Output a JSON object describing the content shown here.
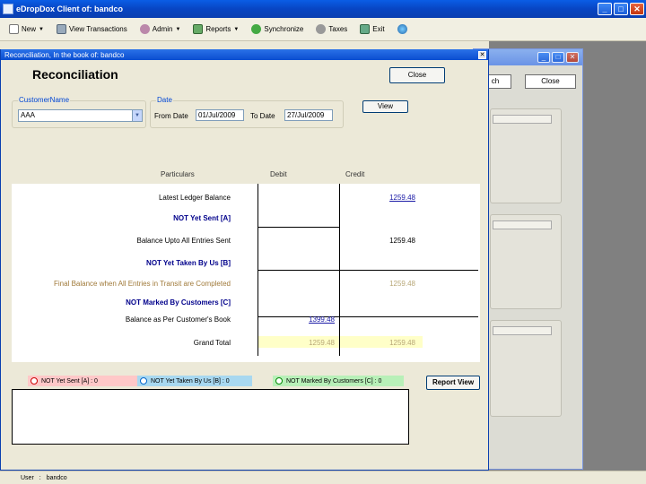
{
  "app": {
    "title": "eDropDox Client of: bandco"
  },
  "toolbar": {
    "items": [
      {
        "label": "New",
        "icon": "new-document-icon",
        "has_menu": true
      },
      {
        "label": "View Transactions",
        "icon": "view-transactions-icon",
        "has_menu": false
      },
      {
        "label": "Admin",
        "icon": "admin-icon",
        "has_menu": true
      },
      {
        "label": "Reports",
        "icon": "reports-icon",
        "has_menu": true
      },
      {
        "label": "Synchronize",
        "icon": "synchronize-icon",
        "has_menu": false
      },
      {
        "label": "Taxes",
        "icon": "taxes-icon",
        "has_menu": false
      },
      {
        "label": "Exit",
        "icon": "exit-icon",
        "has_menu": false
      }
    ],
    "globe_icon": "globe-icon"
  },
  "background_window": {
    "search_label": "ch",
    "close_label": "Close"
  },
  "window": {
    "title": "Reconciliation, In the book of: bandco",
    "heading": "Reconciliation",
    "close_label": "Close",
    "view_label": "View",
    "customer_group_label": "CustomerName",
    "customer_value": "AAA",
    "date_group_label": "Date",
    "from_label": "From Date",
    "from_value": "01/Jul/2009",
    "to_label": "To Date",
    "to_value": "27/Jul/2009"
  },
  "columns": {
    "particulars": "Particulars",
    "debit": "Debit",
    "credit": "Credit"
  },
  "rows": [
    {
      "label": "Latest Ledger Balance",
      "debit": "",
      "credit": "1259.48"
    },
    {
      "label": "NOT Yet Sent   [A]",
      "debit": "",
      "credit": ""
    },
    {
      "label": "Balance Upto All Entries Sent",
      "debit": "",
      "credit": "1259.48"
    },
    {
      "label": "NOT Yet Taken By Us   [B]",
      "debit": "",
      "credit": ""
    },
    {
      "label": "Final Balance when All Entries in Transit are Completed",
      "debit": "",
      "credit": "1259.48"
    },
    {
      "label": "NOT Marked  By Customers   [C]",
      "debit": "",
      "credit": ""
    },
    {
      "label": "Balance as Per Customer's Book",
      "debit": "1399.48",
      "credit": ""
    },
    {
      "label": "Grand Total",
      "debit": "1259.48",
      "credit": "1259.48"
    }
  ],
  "status": {
    "a": "NOT Yet Sent   [A] : 0",
    "b": "NOT Yet Taken By Us   [B] : 0",
    "c": "NOT Marked  By Customers   [C] : 0",
    "report_label": "Report View"
  },
  "statusbar": {
    "user_label": "User",
    "user_value": "bandco"
  },
  "colors": {
    "titlebar": "#0a4dd0",
    "status_a": "#ffc8c8",
    "status_b": "#a8d8f0",
    "status_c": "#b8f0b8",
    "highlight": "#ffffc8"
  }
}
